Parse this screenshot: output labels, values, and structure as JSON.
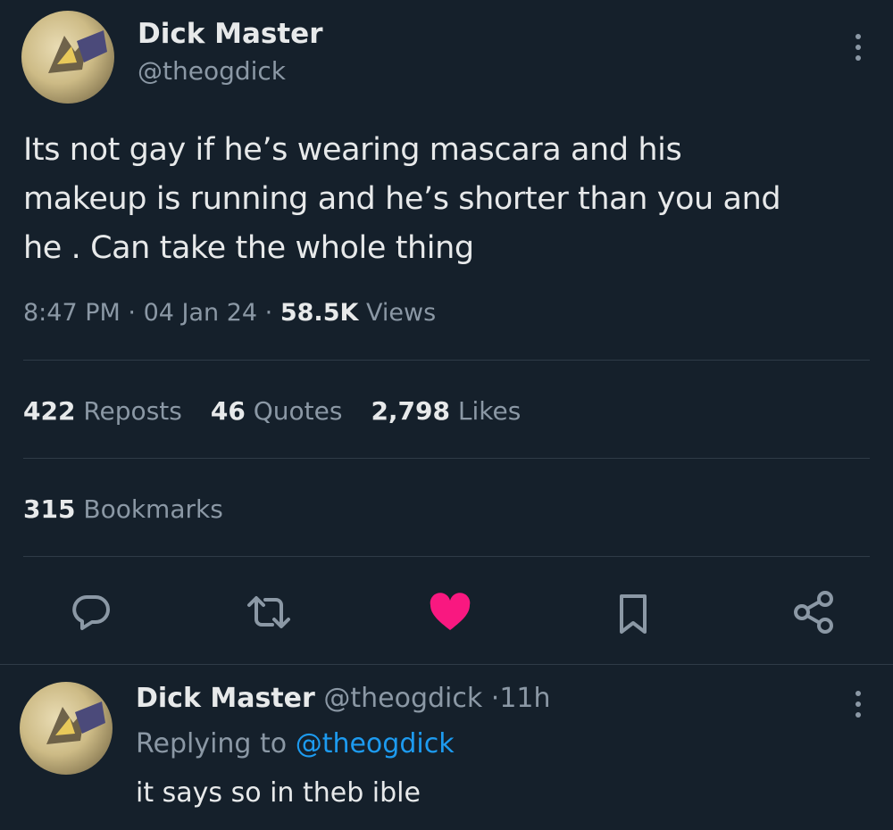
{
  "tweet": {
    "author_name": "Dick Master",
    "author_handle": "@theogdick",
    "text_line1": "Its not gay if he’s wearing mascara and his",
    "text_line2": "makeup is running and he’s shorter than you and",
    "text_line3": "he . Can take the whole thing",
    "time": "8:47 PM",
    "date": "04 Jan 24",
    "sep": "·",
    "views_count": "58.5K",
    "views_label": "Views"
  },
  "stats": {
    "reposts_count": "422",
    "reposts_label": "Reposts",
    "quotes_count": "46",
    "quotes_label": "Quotes",
    "likes_count": "2,798",
    "likes_label": "Likes",
    "bookmarks_count": "315",
    "bookmarks_label": "Bookmarks"
  },
  "actions": [
    "reply-icon",
    "repost-icon",
    "like-icon-filled",
    "bookmark-icon",
    "share-icon"
  ],
  "colors": {
    "background": "#15202b",
    "like": "#f91880",
    "link": "#1d9bf0",
    "muted": "#8b98a5"
  },
  "reply": {
    "author_name": "Dick Master",
    "author_handle": "@theogdick",
    "sep": "·",
    "time_ago": "11h",
    "replying_label": "Replying to",
    "replying_handle": "@theogdick",
    "text": "it says so in theb ible"
  }
}
